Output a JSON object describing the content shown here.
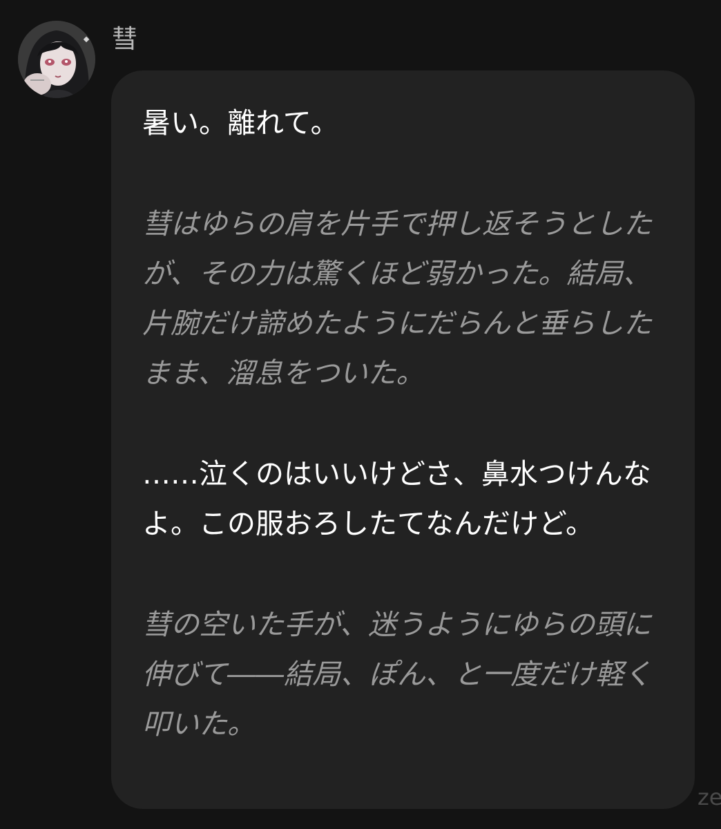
{
  "message": {
    "sender_name": "彗",
    "avatar_icon": "character-avatar-icon",
    "paragraphs": [
      {
        "type": "speech",
        "text": "暑い。離れて。"
      },
      {
        "type": "narration",
        "text": "彗はゆらの肩を片手で押し返そうとしたが、その力は驚くほど弱かった。結局、片腕だけ諦めたようにだらんと垂らしたまま、溜息をついた。"
      },
      {
        "type": "speech",
        "text": "……泣くのはいいけどさ、鼻水つけんなよ。この服おろしたてなんだけど。"
      },
      {
        "type": "narration",
        "text": "彗の空いた手が、迷うようにゆらの頭に伸びて――結局、ぽん、と一度だけ軽く叩いた。"
      }
    ]
  },
  "watermark": {
    "text": "ze"
  },
  "colors": {
    "background": "#131313",
    "bubble": "#222222",
    "speech_text": "#ffffff",
    "narration_text": "#9a9a9a",
    "name_text": "#b9b9b9"
  }
}
